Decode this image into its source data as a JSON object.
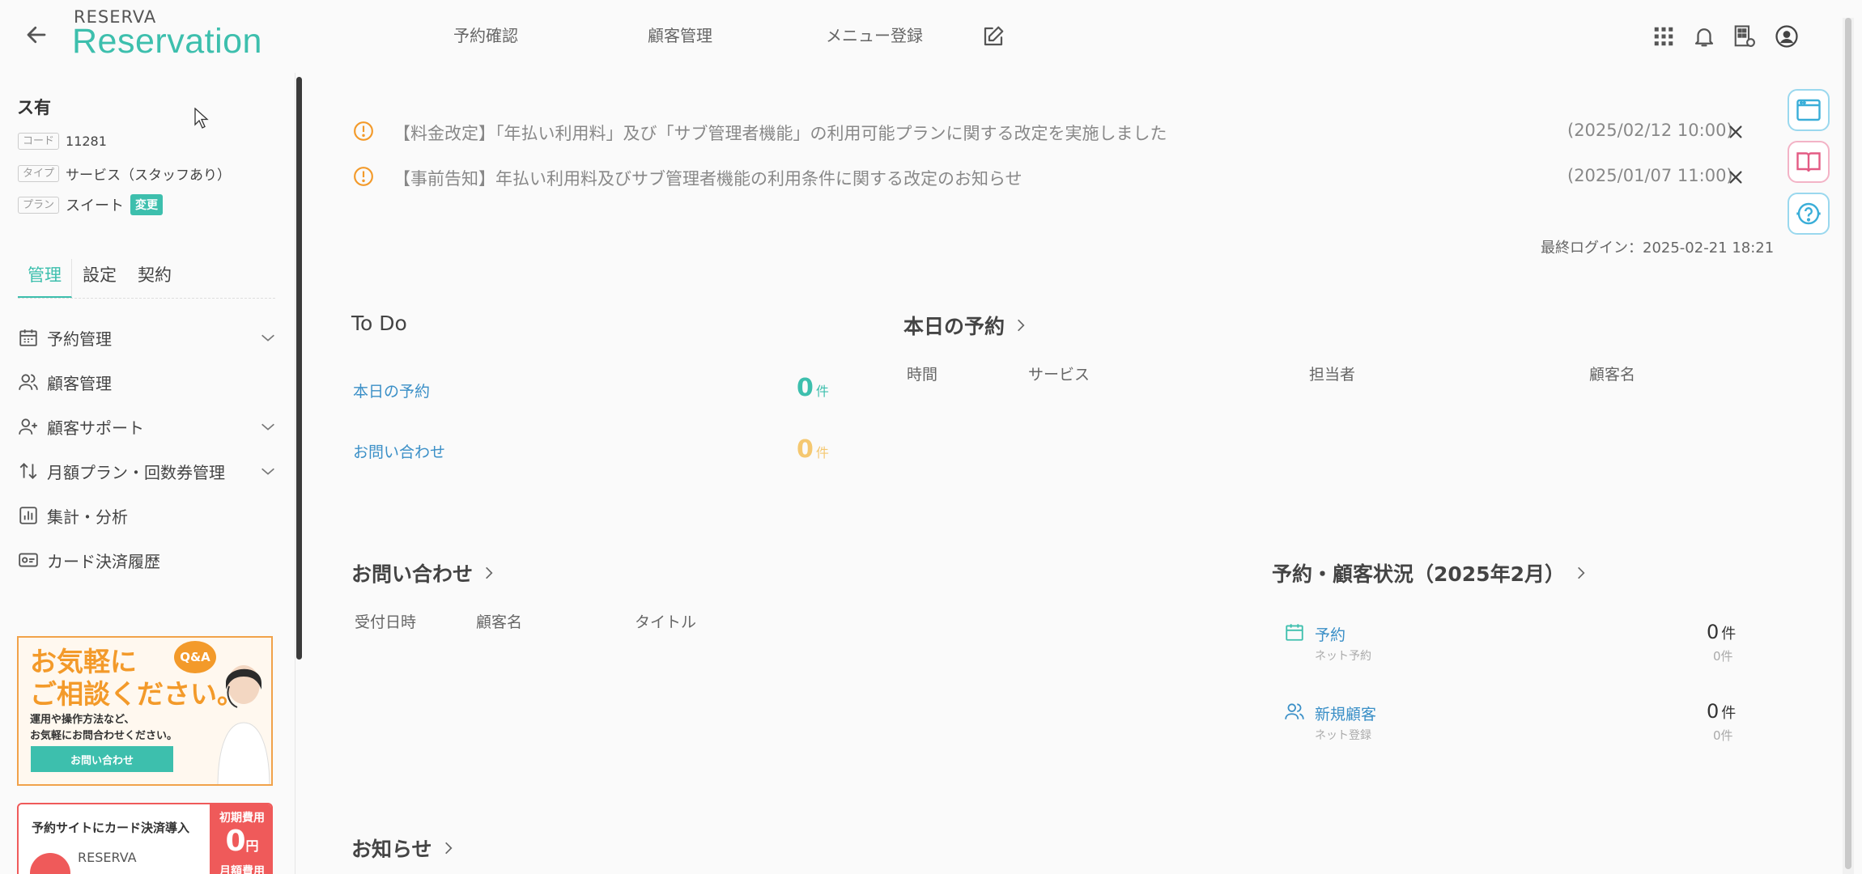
{
  "header": {
    "logo_top": "RESERVA",
    "logo_main": "Reservation",
    "nav": [
      "予約確認",
      "顧客管理",
      "メニュー登録"
    ]
  },
  "sidebar": {
    "store_name": "ス有",
    "meta": [
      {
        "tag": "コード",
        "value": "11281"
      },
      {
        "tag": "タイプ",
        "value": "サービス（スタッフあり）"
      },
      {
        "tag": "プラン",
        "value": "スイート",
        "badge": "変更"
      }
    ],
    "tabs": [
      "管理",
      "設定",
      "契約"
    ],
    "menu": [
      {
        "label": "予約管理",
        "icon": "calendar-icon",
        "chevron": true
      },
      {
        "label": "顧客管理",
        "icon": "users-icon",
        "chevron": false
      },
      {
        "label": "顧客サポート",
        "icon": "user-plus-icon",
        "chevron": true
      },
      {
        "label": "月額プラン・回数券管理",
        "icon": "repeat-icon",
        "chevron": true
      },
      {
        "label": "集計・分析",
        "icon": "bar-chart-icon",
        "chevron": false
      },
      {
        "label": "カード決済履歴",
        "icon": "card-icon",
        "chevron": false
      }
    ],
    "banner1": {
      "title_line1": "お気軽に",
      "title_line2": "ご相談ください。",
      "sub_line1": "運用や操作方法など、",
      "sub_line2": "お気軽にお問合わせください。",
      "button": "お問い合わせ",
      "qa": "Q&A"
    },
    "banner2": {
      "text": "予約サイトにカード決済導入",
      "red_line1": "初期費用",
      "red_value": "0",
      "red_unit": "円",
      "red_line3": "月額費用",
      "brand": "RESERVA"
    }
  },
  "notices": [
    {
      "text": "【料金改定】「年払い利用料」及び「サブ管理者機能」の利用可能プランに関する改定を実施しました",
      "date": "(2025/02/12 10:00)"
    },
    {
      "text": "【事前告知】年払い利用料及びサブ管理者機能の利用条件に関する改定のお知らせ",
      "date": "(2025/01/07 11:00)"
    }
  ],
  "last_login": "最終ログイン：2025-02-21 18:21",
  "todo": {
    "title": "To Do",
    "items": [
      {
        "label": "本日の予約",
        "count": "0",
        "unit": "件"
      },
      {
        "label": "お問い合わせ",
        "count": "0",
        "unit": "件"
      }
    ]
  },
  "today": {
    "title": "本日の予約",
    "columns": [
      "時間",
      "サービス",
      "担当者",
      "顧客名"
    ]
  },
  "inquiries": {
    "title": "お問い合わせ",
    "columns": [
      "受付日時",
      "顧客名",
      "タイトル"
    ]
  },
  "status": {
    "title": "予約・顧客状況（2025年2月）",
    "items": [
      {
        "label": "予約",
        "sub": "ネット予約",
        "count": "0",
        "unit": "件",
        "subcount": "0件"
      },
      {
        "label": "新規顧客",
        "sub": "ネット登録",
        "count": "0",
        "unit": "件",
        "subcount": "0件"
      }
    ]
  },
  "news": {
    "title": "お知らせ"
  },
  "colors": {
    "accent": "#3dbfad",
    "link": "#3a8fc7",
    "warning": "#f39a2a",
    "todo_zero_teal": "#3dbfad",
    "todo_zero_orange": "#f5c870"
  }
}
